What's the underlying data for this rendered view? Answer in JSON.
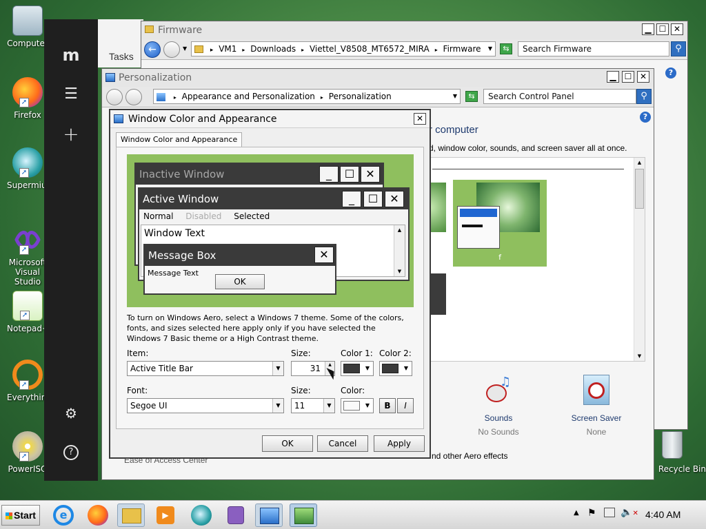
{
  "desktop": {
    "icons": [
      {
        "label": "Computer"
      },
      {
        "label": "Firefox"
      },
      {
        "label": "Supermium"
      },
      {
        "label": "Microsoft Visual Studio"
      },
      {
        "label": "Notepad++"
      },
      {
        "label": "Everything"
      },
      {
        "label": "PowerISO"
      },
      {
        "label": "Recycle Bin"
      }
    ]
  },
  "sidebar": {
    "logo": "m",
    "tasks_label": "Tasks"
  },
  "firmware_window": {
    "title": "Firmware",
    "breadcrumb": [
      "VM1",
      "Downloads",
      "Viettel_V8508_MT6572_MIRA",
      "Firmware"
    ],
    "search_placeholder": "Search Firmware"
  },
  "personalization_window": {
    "title": "Personalization",
    "breadcrumb": [
      "Appearance and Personalization",
      "Personalization"
    ],
    "search_placeholder": "Search Control Panel",
    "heading_fragment": "r computer",
    "subtext_fragment": "d, window color, sounds, and screen saver all at once.",
    "theme_caption": "f",
    "bottom_text": "nd other Aero effects",
    "ease_link": "Ease of Access Center",
    "sounds": {
      "label": "Sounds",
      "value": "No Sounds"
    },
    "screen_saver": {
      "label": "Screen Saver",
      "value": "None"
    }
  },
  "dialog": {
    "title": "Window Color and Appearance",
    "tab": "Window Color and Appearance",
    "preview": {
      "inactive_title": "Inactive Window",
      "active_title": "Active Window",
      "menu": [
        "Normal",
        "Disabled",
        "Selected"
      ],
      "window_text": "Window Text",
      "msgbox_title": "Message Box",
      "msgbox_text": "Message Text",
      "msgbox_ok": "OK"
    },
    "info": "To turn on Windows Aero, select a Windows 7 theme.  Some of the colors, fonts, and sizes selected here apply only if you have selected the Windows 7 Basic theme or a High Contrast theme.",
    "item_label": "Item:",
    "item_value": "Active Title Bar",
    "size_label": "Size:",
    "size_value": "31",
    "color1_label": "Color 1:",
    "color2_label": "Color 2:",
    "font_label": "Font:",
    "font_value": "Segoe UI",
    "font_size_label": "Size:",
    "font_size_value": "11",
    "font_color_label": "Color:",
    "bold_label": "B",
    "italic_label": "I",
    "ok": "OK",
    "cancel": "Cancel",
    "apply": "Apply"
  },
  "taskbar": {
    "start": "Start",
    "clock": "4:40 AM"
  },
  "colors": {
    "preview_bg": "#8fbf5e",
    "dark_titlebar": "#3a3a3a",
    "theme_tile": "#8fbf5e",
    "sidebar": "#1f1f1f"
  }
}
